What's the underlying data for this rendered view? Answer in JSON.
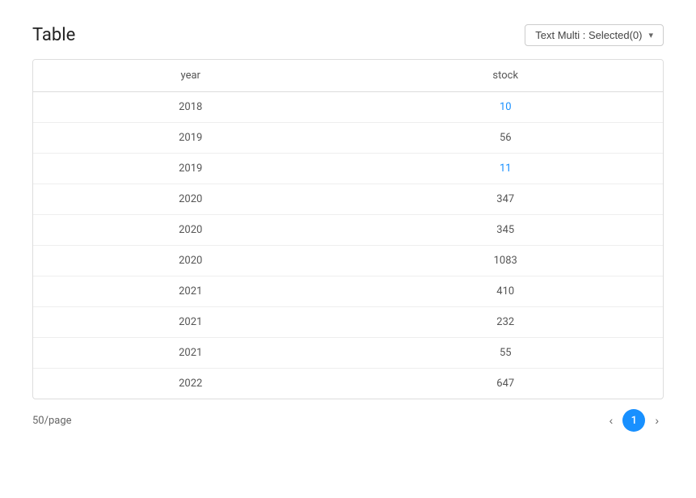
{
  "header": {
    "title": "Table",
    "dropdown_label": "Text Multi : Selected(0)",
    "dropdown_icon": "▾"
  },
  "table": {
    "columns": [
      {
        "key": "year",
        "label": "year"
      },
      {
        "key": "stock",
        "label": "stock"
      }
    ],
    "rows": [
      {
        "year": "2018",
        "stock": "10",
        "stock_highlight": true
      },
      {
        "year": "2019",
        "stock": "56",
        "stock_highlight": false
      },
      {
        "year": "2019",
        "stock": "11",
        "stock_highlight": true
      },
      {
        "year": "2020",
        "stock": "347",
        "stock_highlight": false
      },
      {
        "year": "2020",
        "stock": "345",
        "stock_highlight": false
      },
      {
        "year": "2020",
        "stock": "1083",
        "stock_highlight": false
      },
      {
        "year": "2021",
        "stock": "410",
        "stock_highlight": false
      },
      {
        "year": "2021",
        "stock": "232",
        "stock_highlight": false
      },
      {
        "year": "2021",
        "stock": "55",
        "stock_highlight": false
      },
      {
        "year": "2022",
        "stock": "647",
        "stock_highlight": false
      }
    ]
  },
  "footer": {
    "per_page": "50/page",
    "current_page": "1",
    "prev_icon": "‹",
    "next_icon": "›"
  }
}
